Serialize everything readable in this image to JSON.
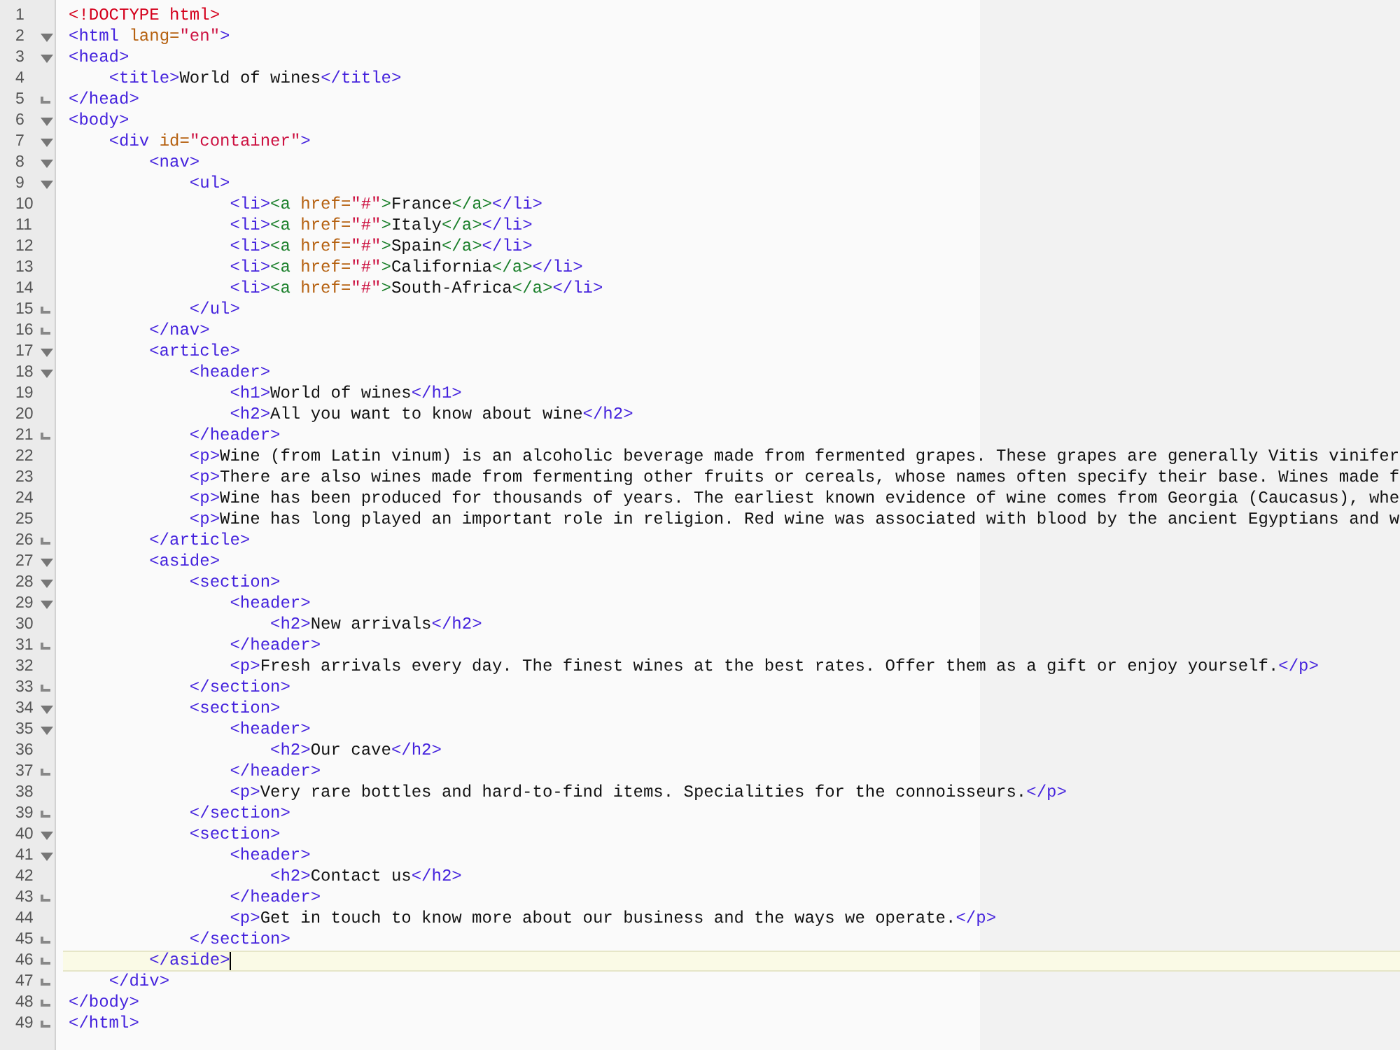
{
  "editor": {
    "lines": [
      {
        "number": "1",
        "kind": "none",
        "current": false,
        "segments": [
          {
            "kind": "doctype",
            "text": "<!DOCTYPE html>"
          }
        ]
      },
      {
        "number": "2",
        "kind": "open",
        "current": false,
        "segments": [
          {
            "kind": "tag",
            "text": "<html "
          },
          {
            "kind": "attr",
            "text": "lang="
          },
          {
            "kind": "value",
            "text": "\"en\""
          },
          {
            "kind": "tag",
            "text": ">"
          }
        ]
      },
      {
        "number": "3",
        "kind": "open",
        "current": false,
        "segments": [
          {
            "kind": "tag",
            "text": "<head>"
          }
        ]
      },
      {
        "number": "4",
        "kind": "none",
        "current": false,
        "segments": [
          {
            "kind": "tag",
            "text": "    <title>"
          },
          {
            "kind": "text",
            "text": "World of wines"
          },
          {
            "kind": "tag",
            "text": "</title>"
          }
        ]
      },
      {
        "number": "5",
        "kind": "end",
        "current": false,
        "segments": [
          {
            "kind": "tag",
            "text": "</head>"
          }
        ]
      },
      {
        "number": "6",
        "kind": "open",
        "current": false,
        "segments": [
          {
            "kind": "tag",
            "text": "<body>"
          }
        ]
      },
      {
        "number": "7",
        "kind": "open",
        "current": false,
        "segments": [
          {
            "kind": "tag",
            "text": "    <div "
          },
          {
            "kind": "attr",
            "text": "id="
          },
          {
            "kind": "value",
            "text": "\"container\""
          },
          {
            "kind": "tag",
            "text": ">"
          }
        ]
      },
      {
        "number": "8",
        "kind": "open",
        "current": false,
        "segments": [
          {
            "kind": "tag",
            "text": "        <nav>"
          }
        ]
      },
      {
        "number": "9",
        "kind": "open",
        "current": false,
        "segments": [
          {
            "kind": "tag",
            "text": "            <ul>"
          }
        ]
      },
      {
        "number": "10",
        "kind": "none",
        "current": false,
        "segments": [
          {
            "kind": "tag",
            "text": "                <li>"
          },
          {
            "kind": "link",
            "text": "<a "
          },
          {
            "kind": "attr",
            "text": "href="
          },
          {
            "kind": "value",
            "text": "\"#\""
          },
          {
            "kind": "link",
            "text": ">"
          },
          {
            "kind": "text",
            "text": "France"
          },
          {
            "kind": "link",
            "text": "</a>"
          },
          {
            "kind": "tag",
            "text": "</li>"
          }
        ]
      },
      {
        "number": "11",
        "kind": "none",
        "current": false,
        "segments": [
          {
            "kind": "tag",
            "text": "                <li>"
          },
          {
            "kind": "link",
            "text": "<a "
          },
          {
            "kind": "attr",
            "text": "href="
          },
          {
            "kind": "value",
            "text": "\"#\""
          },
          {
            "kind": "link",
            "text": ">"
          },
          {
            "kind": "text",
            "text": "Italy"
          },
          {
            "kind": "link",
            "text": "</a>"
          },
          {
            "kind": "tag",
            "text": "</li>"
          }
        ]
      },
      {
        "number": "12",
        "kind": "none",
        "current": false,
        "segments": [
          {
            "kind": "tag",
            "text": "                <li>"
          },
          {
            "kind": "link",
            "text": "<a "
          },
          {
            "kind": "attr",
            "text": "href="
          },
          {
            "kind": "value",
            "text": "\"#\""
          },
          {
            "kind": "link",
            "text": ">"
          },
          {
            "kind": "text",
            "text": "Spain"
          },
          {
            "kind": "link",
            "text": "</a>"
          },
          {
            "kind": "tag",
            "text": "</li>"
          }
        ]
      },
      {
        "number": "13",
        "kind": "none",
        "current": false,
        "segments": [
          {
            "kind": "tag",
            "text": "                <li>"
          },
          {
            "kind": "link",
            "text": "<a "
          },
          {
            "kind": "attr",
            "text": "href="
          },
          {
            "kind": "value",
            "text": "\"#\""
          },
          {
            "kind": "link",
            "text": ">"
          },
          {
            "kind": "text",
            "text": "California"
          },
          {
            "kind": "link",
            "text": "</a>"
          },
          {
            "kind": "tag",
            "text": "</li>"
          }
        ]
      },
      {
        "number": "14",
        "kind": "none",
        "current": false,
        "segments": [
          {
            "kind": "tag",
            "text": "                <li>"
          },
          {
            "kind": "link",
            "text": "<a "
          },
          {
            "kind": "attr",
            "text": "href="
          },
          {
            "kind": "value",
            "text": "\"#\""
          },
          {
            "kind": "link",
            "text": ">"
          },
          {
            "kind": "text",
            "text": "South-Africa"
          },
          {
            "kind": "link",
            "text": "</a>"
          },
          {
            "kind": "tag",
            "text": "</li>"
          }
        ]
      },
      {
        "number": "15",
        "kind": "end",
        "current": false,
        "segments": [
          {
            "kind": "tag",
            "text": "            </ul>"
          }
        ]
      },
      {
        "number": "16",
        "kind": "end",
        "current": false,
        "segments": [
          {
            "kind": "tag",
            "text": "        </nav>"
          }
        ]
      },
      {
        "number": "17",
        "kind": "open",
        "current": false,
        "segments": [
          {
            "kind": "tag",
            "text": "        <article>"
          }
        ]
      },
      {
        "number": "18",
        "kind": "open",
        "current": false,
        "segments": [
          {
            "kind": "tag",
            "text": "            <header>"
          }
        ]
      },
      {
        "number": "19",
        "kind": "none",
        "current": false,
        "segments": [
          {
            "kind": "tag",
            "text": "                <h1>"
          },
          {
            "kind": "text",
            "text": "World of wines"
          },
          {
            "kind": "tag",
            "text": "</h1>"
          }
        ]
      },
      {
        "number": "20",
        "kind": "none",
        "current": false,
        "segments": [
          {
            "kind": "tag",
            "text": "                <h2>"
          },
          {
            "kind": "text",
            "text": "All you want to know about wine"
          },
          {
            "kind": "tag",
            "text": "</h2>"
          }
        ]
      },
      {
        "number": "21",
        "kind": "end",
        "current": false,
        "segments": [
          {
            "kind": "tag",
            "text": "            </header>"
          }
        ]
      },
      {
        "number": "22",
        "kind": "none",
        "current": false,
        "segments": [
          {
            "kind": "tag",
            "text": "            <p>"
          },
          {
            "kind": "text",
            "text": "Wine (from Latin vinum) is an alcoholic beverage made from fermented grapes. These grapes are generally Vitis vinifer"
          }
        ]
      },
      {
        "number": "23",
        "kind": "none",
        "current": false,
        "segments": [
          {
            "kind": "tag",
            "text": "            <p>"
          },
          {
            "kind": "text",
            "text": "There are also wines made from fermenting other fruits or cereals, whose names often specify their base. Wines made f"
          }
        ]
      },
      {
        "number": "24",
        "kind": "none",
        "current": false,
        "segments": [
          {
            "kind": "tag",
            "text": "            <p>"
          },
          {
            "kind": "text",
            "text": "Wine has been produced for thousands of years. The earliest known evidence of wine comes from Georgia (Caucasus), whe"
          }
        ]
      },
      {
        "number": "25",
        "kind": "none",
        "current": false,
        "segments": [
          {
            "kind": "tag",
            "text": "            <p>"
          },
          {
            "kind": "text",
            "text": "Wine has long played an important role in religion. Red wine was associated with blood by the ancient Egyptians and w"
          }
        ]
      },
      {
        "number": "26",
        "kind": "end",
        "current": false,
        "segments": [
          {
            "kind": "tag",
            "text": "        </article>"
          }
        ]
      },
      {
        "number": "27",
        "kind": "open",
        "current": false,
        "segments": [
          {
            "kind": "tag",
            "text": "        <aside>"
          }
        ]
      },
      {
        "number": "28",
        "kind": "open",
        "current": false,
        "segments": [
          {
            "kind": "tag",
            "text": "            <section>"
          }
        ]
      },
      {
        "number": "29",
        "kind": "open",
        "current": false,
        "segments": [
          {
            "kind": "tag",
            "text": "                <header>"
          }
        ]
      },
      {
        "number": "30",
        "kind": "none",
        "current": false,
        "segments": [
          {
            "kind": "tag",
            "text": "                    <h2>"
          },
          {
            "kind": "text",
            "text": "New arrivals"
          },
          {
            "kind": "tag",
            "text": "</h2>"
          }
        ]
      },
      {
        "number": "31",
        "kind": "end",
        "current": false,
        "segments": [
          {
            "kind": "tag",
            "text": "                </header>"
          }
        ]
      },
      {
        "number": "32",
        "kind": "none",
        "current": false,
        "segments": [
          {
            "kind": "tag",
            "text": "                <p>"
          },
          {
            "kind": "text",
            "text": "Fresh arrivals every day. The finest wines at the best rates. Offer them as a gift or enjoy yourself."
          },
          {
            "kind": "tag",
            "text": "</p>"
          }
        ]
      },
      {
        "number": "33",
        "kind": "end",
        "current": false,
        "segments": [
          {
            "kind": "tag",
            "text": "            </section>"
          }
        ]
      },
      {
        "number": "34",
        "kind": "open",
        "current": false,
        "segments": [
          {
            "kind": "tag",
            "text": "            <section>"
          }
        ]
      },
      {
        "number": "35",
        "kind": "open",
        "current": false,
        "segments": [
          {
            "kind": "tag",
            "text": "                <header>"
          }
        ]
      },
      {
        "number": "36",
        "kind": "none",
        "current": false,
        "segments": [
          {
            "kind": "tag",
            "text": "                    <h2>"
          },
          {
            "kind": "text",
            "text": "Our cave"
          },
          {
            "kind": "tag",
            "text": "</h2>"
          }
        ]
      },
      {
        "number": "37",
        "kind": "end",
        "current": false,
        "segments": [
          {
            "kind": "tag",
            "text": "                </header>"
          }
        ]
      },
      {
        "number": "38",
        "kind": "none",
        "current": false,
        "segments": [
          {
            "kind": "tag",
            "text": "                <p>"
          },
          {
            "kind": "text",
            "text": "Very rare bottles and hard-to-find items. Specialities for the connoisseurs."
          },
          {
            "kind": "tag",
            "text": "</p>"
          }
        ]
      },
      {
        "number": "39",
        "kind": "end",
        "current": false,
        "segments": [
          {
            "kind": "tag",
            "text": "            </section>"
          }
        ]
      },
      {
        "number": "40",
        "kind": "open",
        "current": false,
        "segments": [
          {
            "kind": "tag",
            "text": "            <section>"
          }
        ]
      },
      {
        "number": "41",
        "kind": "open",
        "current": false,
        "segments": [
          {
            "kind": "tag",
            "text": "                <header>"
          }
        ]
      },
      {
        "number": "42",
        "kind": "none",
        "current": false,
        "segments": [
          {
            "kind": "tag",
            "text": "                    <h2>"
          },
          {
            "kind": "text",
            "text": "Contact us"
          },
          {
            "kind": "tag",
            "text": "</h2>"
          }
        ]
      },
      {
        "number": "43",
        "kind": "end",
        "current": false,
        "segments": [
          {
            "kind": "tag",
            "text": "                </header>"
          }
        ]
      },
      {
        "number": "44",
        "kind": "none",
        "current": false,
        "segments": [
          {
            "kind": "tag",
            "text": "                <p>"
          },
          {
            "kind": "text",
            "text": "Get in touch to know more about our business and the ways we operate."
          },
          {
            "kind": "tag",
            "text": "</p>"
          }
        ]
      },
      {
        "number": "45",
        "kind": "end",
        "current": false,
        "segments": [
          {
            "kind": "tag",
            "text": "            </section>"
          }
        ]
      },
      {
        "number": "46",
        "kind": "end",
        "current": true,
        "segments": [
          {
            "kind": "tag",
            "text": "        </aside>"
          }
        ]
      },
      {
        "number": "47",
        "kind": "end",
        "current": false,
        "segments": [
          {
            "kind": "tag",
            "text": "    </div>"
          }
        ]
      },
      {
        "number": "48",
        "kind": "end",
        "current": false,
        "segments": [
          {
            "kind": "tag",
            "text": "</body>"
          }
        ]
      },
      {
        "number": "49",
        "kind": "end",
        "current": false,
        "segments": [
          {
            "kind": "tag",
            "text": "</html>"
          }
        ]
      }
    ]
  }
}
